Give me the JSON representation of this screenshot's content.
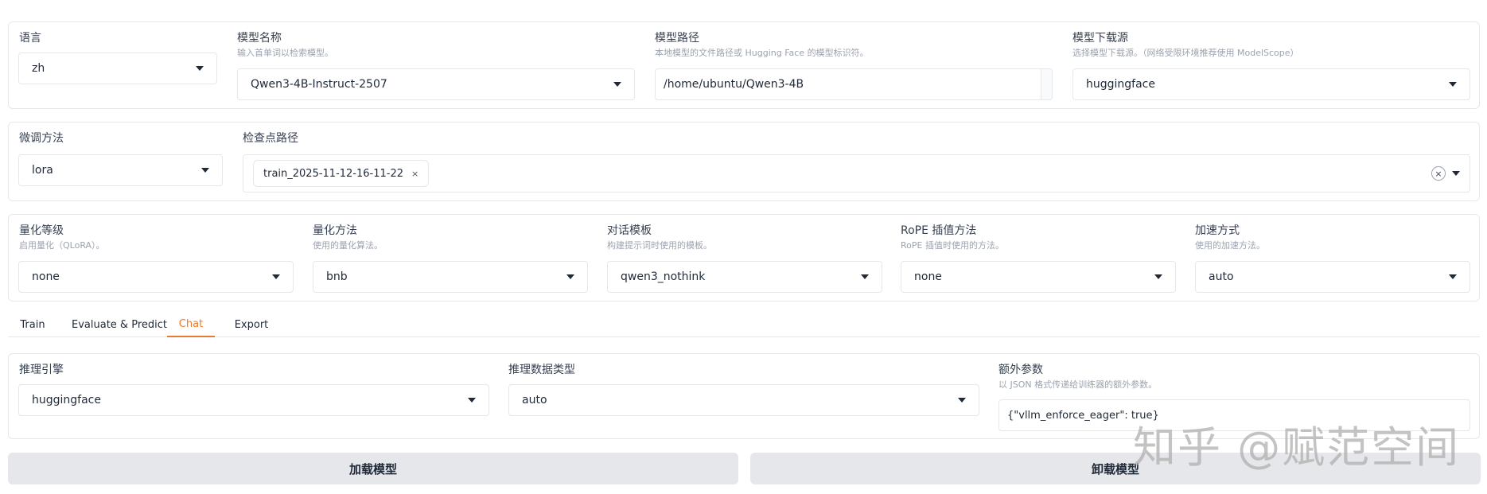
{
  "row1": {
    "language": {
      "label": "语言",
      "value": "zh"
    },
    "model_name": {
      "label": "模型名称",
      "info": "输入首单词以检索模型。",
      "value": "Qwen3-4B-Instruct-2507"
    },
    "model_path": {
      "label": "模型路径",
      "info": "本地模型的文件路径或 Hugging Face 的模型标识符。",
      "value": "/home/ubuntu/Qwen3-4B"
    },
    "hub": {
      "label": "模型下载源",
      "info": "选择模型下载源。（网络受限环境推荐使用 ModelScope）",
      "value": "huggingface"
    }
  },
  "row2": {
    "finetuning_type": {
      "label": "微调方法",
      "value": "lora"
    },
    "checkpoint_path": {
      "label": "检查点路径",
      "chip": "train_2025-11-12-16-11-22",
      "chip_remove": "×",
      "clear": "×"
    }
  },
  "row3": {
    "quant_bit": {
      "label": "量化等级",
      "info": "启用量化（QLoRA）。",
      "value": "none"
    },
    "quant_method": {
      "label": "量化方法",
      "info": "使用的量化算法。",
      "value": "bnb"
    },
    "template": {
      "label": "对话模板",
      "info": "构建提示词时使用的模板。",
      "value": "qwen3_nothink"
    },
    "rope_scaling": {
      "label": "RoPE 插值方法",
      "info": "RoPE 插值时使用的方法。",
      "value": "none"
    },
    "booster": {
      "label": "加速方式",
      "info": "使用的加速方法。",
      "value": "auto"
    }
  },
  "tabs": [
    {
      "label": "Train"
    },
    {
      "label": "Evaluate & Predict"
    },
    {
      "label": "Chat"
    },
    {
      "label": "Export"
    }
  ],
  "chat": {
    "infer_backend": {
      "label": "推理引擎",
      "value": "huggingface"
    },
    "infer_dtype": {
      "label": "推理数据类型",
      "value": "auto"
    },
    "extra_args": {
      "label": "额外参数",
      "info": "以 JSON 格式传递给训练器的额外参数。",
      "value": "{\"vllm_enforce_eager\": true}"
    }
  },
  "buttons": {
    "load": "加载模型",
    "unload": "卸载模型"
  },
  "watermark": "知乎 @赋范空间",
  "colors": {
    "accent": "#ea7a2c",
    "button_bg": "#e5e7eb",
    "border": "#e5e7eb"
  }
}
